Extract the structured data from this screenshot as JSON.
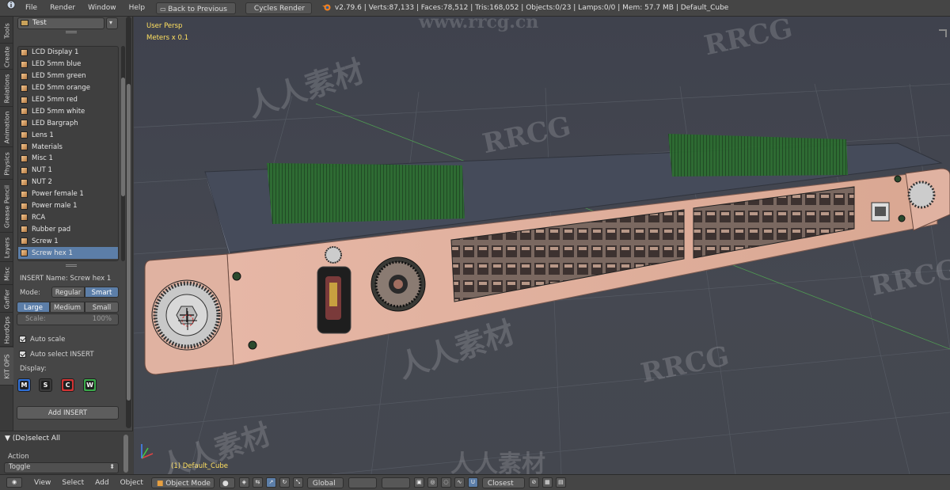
{
  "topbar": {
    "menus": [
      "File",
      "Render",
      "Window",
      "Help"
    ],
    "back_label": "Back to Previous",
    "engine": "Cycles Render",
    "stats": "v2.79.6 | Verts:87,133 | Faces:78,512 | Tris:168,052 | Objects:0/23 | Lamps:0/0 | Mem: 57.7 MB | Default_Cube"
  },
  "tabs": [
    "Tools",
    "Create",
    "Relations",
    "Animation",
    "Physics",
    "Grease Pencil",
    "Layers",
    "Misc",
    "Gaffer",
    "HardOps",
    "KIT OPS"
  ],
  "panel": {
    "folder_value": "Test",
    "items": [
      "LCD Display 1",
      "LED 5mm blue",
      "LED 5mm green",
      "LED 5mm orange",
      "LED 5mm red",
      "LED 5mm white",
      "LED Bargraph",
      "Lens 1",
      "Materials",
      "Misc 1",
      "NUT 1",
      "NUT 2",
      "Power female 1",
      "Power male 1",
      "RCA",
      "Rubber pad",
      "Screw 1",
      "Screw hex 1"
    ],
    "selected_index": 17,
    "insert_name": "INSERT Name: Screw hex 1",
    "mode_label": "Mode:",
    "mode_options": [
      "Regular",
      "Smart"
    ],
    "mode_selected": "Smart",
    "size_options": [
      "Large",
      "Medium",
      "Small"
    ],
    "size_selected": "Large",
    "scale_label": "Scale:",
    "scale_value": "100%",
    "auto_scale": "Auto scale",
    "auto_select": "Auto select INSERT",
    "display_label": "Display:",
    "display_icons": [
      "M",
      "S",
      "C",
      "W"
    ],
    "display_colors": [
      "#2f6fd6",
      "#3a3a3a",
      "#d23434",
      "#3aa84a"
    ],
    "add_insert": "Add INSERT"
  },
  "operator": {
    "title": "(De)select All",
    "action_label": "Action",
    "action_value": "Toggle"
  },
  "viewport": {
    "view_name": "User Persp",
    "units": "Meters x 0.1",
    "object_label": "(1) Default_Cube",
    "watermarks": [
      "www.rrcg.cn",
      "RRCG",
      "人人素材"
    ]
  },
  "bottombar": {
    "menus": [
      "View",
      "Select",
      "Add",
      "Object"
    ],
    "mode": "Object Mode",
    "orientation": "Global",
    "snap": "Closest"
  }
}
